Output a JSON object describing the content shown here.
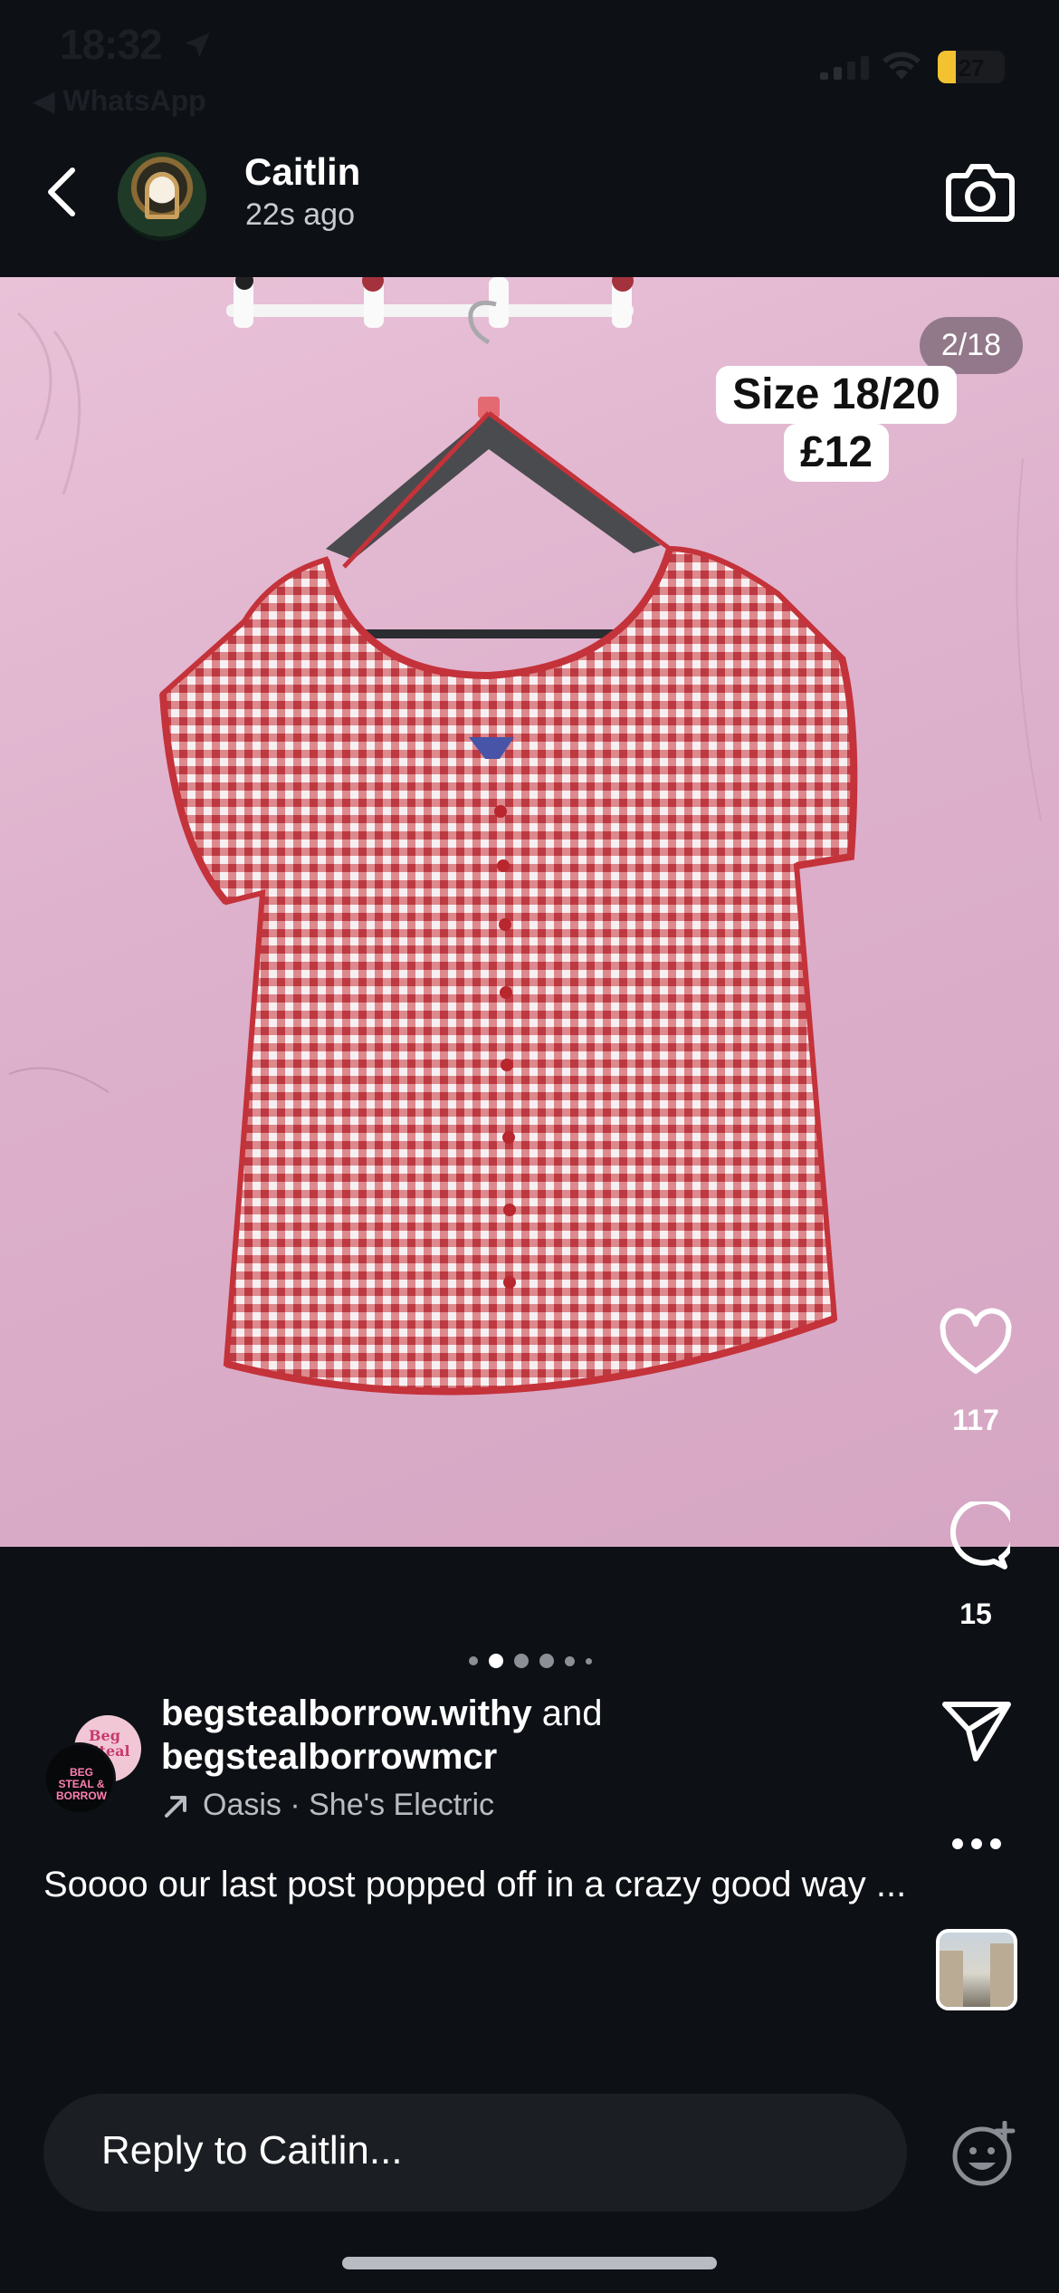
{
  "status_bar": {
    "time": "18:32",
    "back_app": "◀ WhatsApp",
    "battery": "27",
    "battery_level": 0.27
  },
  "header": {
    "user_name": "Caitlin",
    "time_ago": "22s ago"
  },
  "story": {
    "counter": "2/18",
    "sticker_line1": "Size 18/20",
    "sticker_line2": "£12"
  },
  "actions": {
    "like_count": "117",
    "comment_count": "15"
  },
  "pagination": {
    "total": 6,
    "active_index": 1
  },
  "attribution": {
    "author1": "begstealborrow.withy",
    "and_text": " and",
    "author2": "begstealborrowmcr",
    "music": "Oasis · She's Electric",
    "avatar_back_text": "Beg Steal",
    "avatar_front_text": "BEG STEAL & BORROW"
  },
  "caption": "Soooo our last post popped off in a crazy good way ...",
  "reply": {
    "placeholder": "Reply to Caitlin..."
  },
  "colors": {
    "background": "#0d1015",
    "wall_pink": "#e2b8d0",
    "gingham_red": "#c8343a",
    "accent_battery": "#f2c230"
  }
}
